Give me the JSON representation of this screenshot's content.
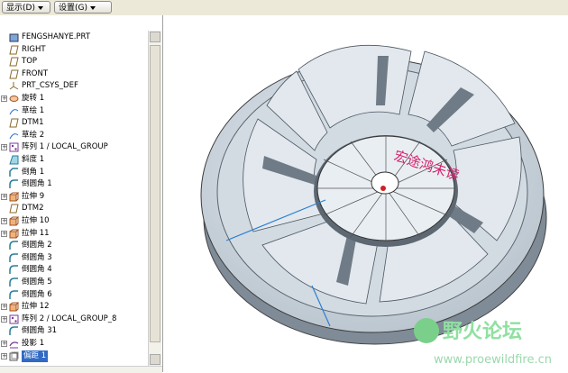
{
  "toolbar": {
    "show_label": "显示",
    "show_key": "(D)",
    "settings_label": "设置",
    "settings_key": "(G)"
  },
  "tree": {
    "items": [
      {
        "label": "FENGSHANYE.PRT",
        "icon": "part-icon",
        "expand": ""
      },
      {
        "label": "RIGHT",
        "icon": "datum-plane-icon",
        "expand": ""
      },
      {
        "label": "TOP",
        "icon": "datum-plane-icon",
        "expand": ""
      },
      {
        "label": "FRONT",
        "icon": "datum-plane-icon",
        "expand": ""
      },
      {
        "label": "PRT_CSYS_DEF",
        "icon": "coordinate-system-icon",
        "expand": ""
      },
      {
        "label": "旋转 1",
        "icon": "revolve-icon",
        "expand": "+"
      },
      {
        "label": "草绘 1",
        "icon": "sketch-icon",
        "expand": ""
      },
      {
        "label": "DTM1",
        "icon": "datum-plane-icon",
        "expand": ""
      },
      {
        "label": "草绘 2",
        "icon": "sketch-icon",
        "expand": ""
      },
      {
        "label": "阵列 1 / LOCAL_GROUP",
        "icon": "pattern-icon",
        "expand": "+"
      },
      {
        "label": "斜度 1",
        "icon": "draft-icon",
        "expand": ""
      },
      {
        "label": "倒角 1",
        "icon": "chamfer-icon",
        "expand": ""
      },
      {
        "label": "倒圆角 1",
        "icon": "round-icon",
        "expand": ""
      },
      {
        "label": "拉伸 9",
        "icon": "extrude-icon",
        "expand": "+"
      },
      {
        "label": "DTM2",
        "icon": "datum-plane-icon",
        "expand": ""
      },
      {
        "label": "拉伸 10",
        "icon": "extrude-icon",
        "expand": "+"
      },
      {
        "label": "拉伸 11",
        "icon": "extrude-icon",
        "expand": "+"
      },
      {
        "label": "倒圆角 2",
        "icon": "round-icon",
        "expand": ""
      },
      {
        "label": "倒圆角 3",
        "icon": "round-icon",
        "expand": ""
      },
      {
        "label": "倒圆角 4",
        "icon": "round-icon",
        "expand": ""
      },
      {
        "label": "倒圆角 5",
        "icon": "round-icon",
        "expand": ""
      },
      {
        "label": "倒圆角 6",
        "icon": "round-icon",
        "expand": ""
      },
      {
        "label": "拉伸 12",
        "icon": "extrude-icon",
        "expand": "+"
      },
      {
        "label": "阵列 2 / LOCAL_GROUP_8",
        "icon": "pattern-icon",
        "expand": "+"
      },
      {
        "label": "倒圆角 31",
        "icon": "round-icon",
        "expand": ""
      },
      {
        "label": "投影 1",
        "icon": "projection-icon",
        "expand": "+"
      },
      {
        "label": "偏距 1",
        "icon": "offset-icon",
        "expand": "+",
        "selected": true
      }
    ]
  },
  "viewport": {
    "watermark_red": "宏途鸿未读",
    "watermark_green": "野火论坛",
    "watermark_url": "www.proewildfire.cn",
    "colors": {
      "part_fill": "#c9d2da",
      "part_shadow": "#8e9aa6",
      "edge": "#3a3a3a",
      "axis": "#2a7fd4"
    }
  }
}
